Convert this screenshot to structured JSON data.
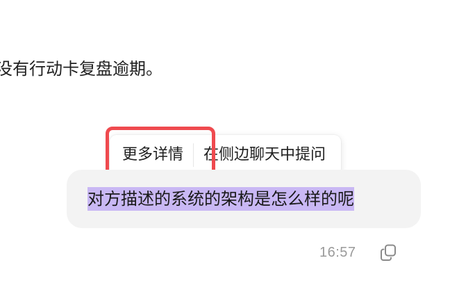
{
  "previous_message": {
    "text": "没有行动卡复盘逾期。"
  },
  "selection_popup": {
    "more_details_label": "更多详情",
    "ask_sidebar_label": "在侧边聊天中提问"
  },
  "user_message": {
    "text": "对方描述的系统的架构是怎么样的呢",
    "timestamp": "16:57"
  },
  "colors": {
    "highlight_outline": "#ef4a4f",
    "selection_highlight": "#c9b8f4",
    "bubble_bg": "#f3f3f3"
  },
  "icons": {
    "copy": "copy-icon"
  }
}
